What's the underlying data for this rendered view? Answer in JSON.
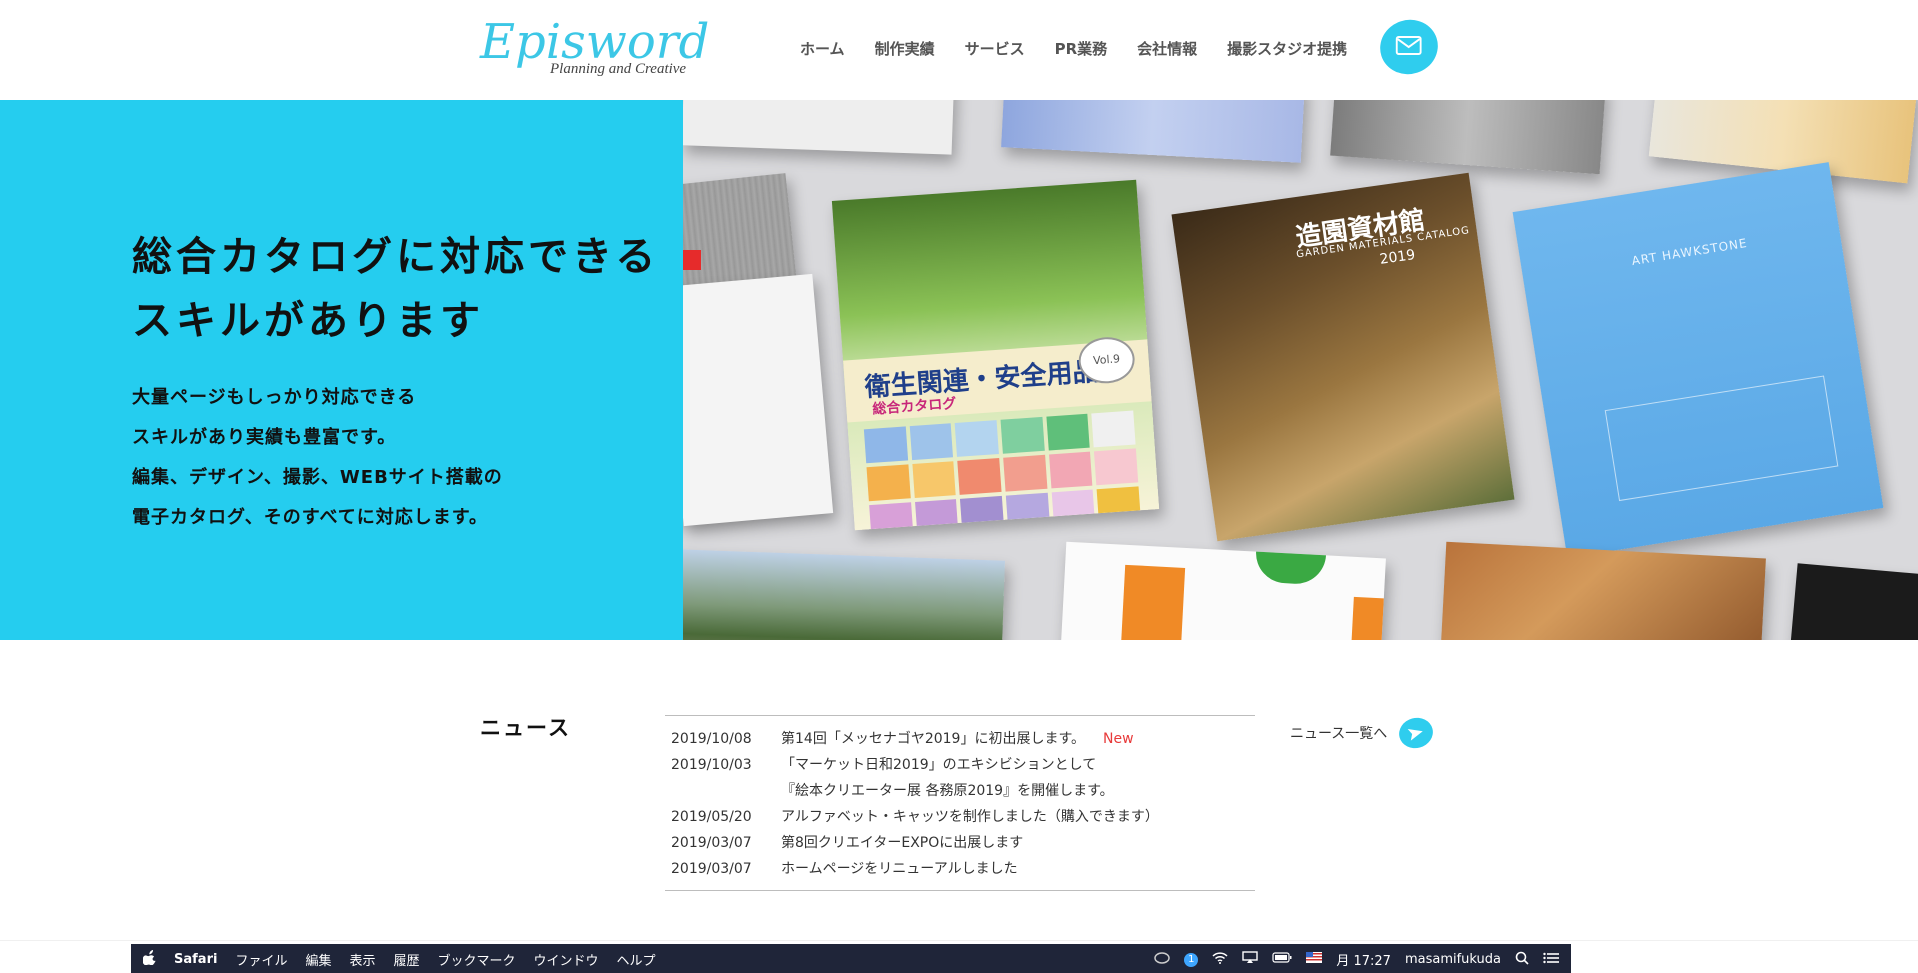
{
  "header": {
    "logo_main": "Episword",
    "logo_sub": "Planning and Creative",
    "nav": [
      {
        "label": "ホーム"
      },
      {
        "label": "制作実績"
      },
      {
        "label": "サービス"
      },
      {
        "label": "PR業務"
      },
      {
        "label": "会社情報"
      },
      {
        "label": "撮影スタジオ提携"
      }
    ],
    "mail_icon": "mail-icon"
  },
  "hero": {
    "title_line1": "総合カタログに対応できる",
    "title_line2": "スキルがあります",
    "desc_line1": "大量ページもしっかり対応できる",
    "desc_line2": "スキルがあり実績も豊富です。",
    "desc_line3": "編集、デザイン、撮影、WEBサイト搭載の",
    "desc_line4": "電子カタログ、そのすべてに対応します。",
    "catalog_green_title": "衛生関連・安全用品",
    "catalog_green_sub": "総合カタログ",
    "catalog_green_vol": "Vol.9",
    "catalog_garden_title": "造園資材館",
    "catalog_garden_sub": "GARDEN MATERIALS CATALOG",
    "catalog_garden_year": "2019",
    "catalog_blue_title": "ART HAWKSTONE",
    "colors": {
      "accent": "#25cdef",
      "brand_logo": "#3cc7e6"
    }
  },
  "news": {
    "heading": "ニュース",
    "items": [
      {
        "date": "2019/10/08",
        "title": "第14回「メッセナゴヤ2019」に初出展します。",
        "badge": "New"
      },
      {
        "date": "2019/10/03",
        "title": "「マーケット日和2019」のエキシビションとして",
        "title2": "『絵本クリエーター展 各務原2019』を開催します。"
      },
      {
        "date": "2019/05/20",
        "title": "アルファベット・キャッツを制作しました（購入できます）"
      },
      {
        "date": "2019/03/07",
        "title": "第8回クリエイターEXPOに出展します"
      },
      {
        "date": "2019/03/07",
        "title": "ホームページをリニューアルしました"
      }
    ],
    "more_label": "ニュース一覧へ"
  },
  "menubar": {
    "apple_icon": "apple-icon",
    "app_name": "Safari",
    "menus": [
      "ファイル",
      "編集",
      "表示",
      "履歴",
      "ブックマーク",
      "ウインドウ",
      "ヘルプ"
    ],
    "badge": "1",
    "clock": "月 17:27",
    "user": "masamifukuda"
  }
}
